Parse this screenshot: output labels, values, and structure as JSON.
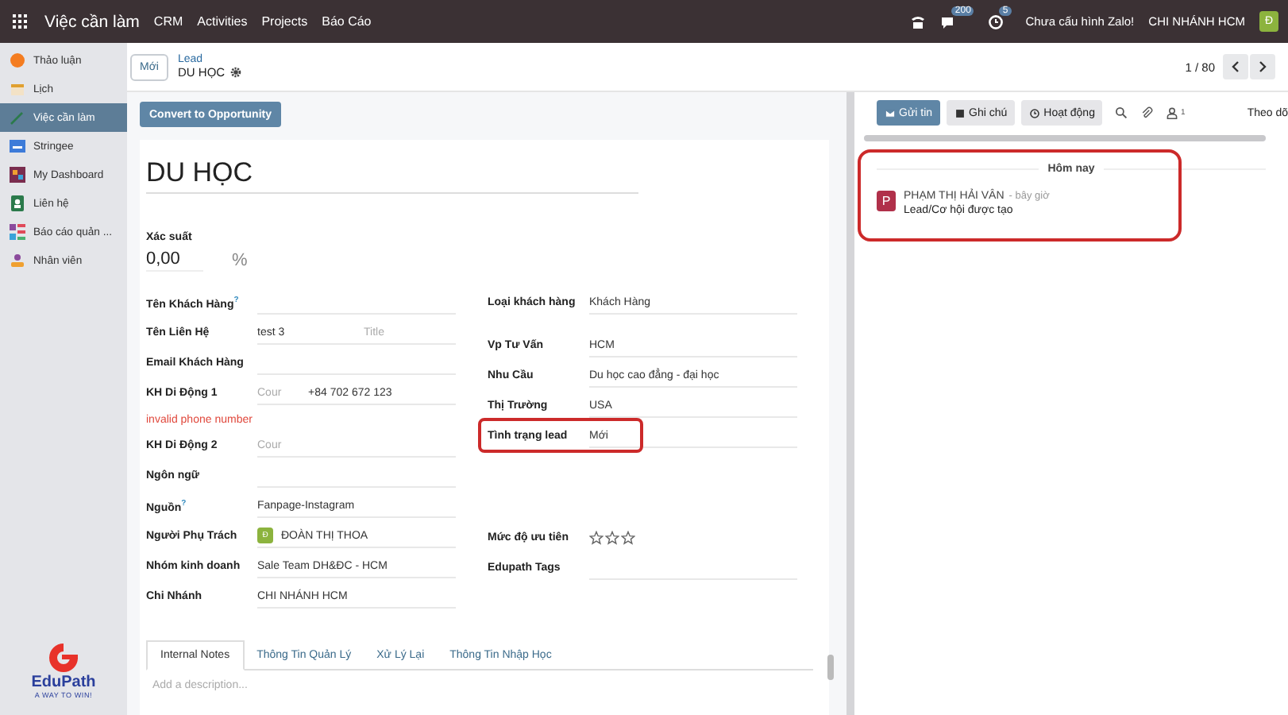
{
  "navbar": {
    "app_name": "Việc cần làm",
    "menu": [
      "CRM",
      "Activities",
      "Projects",
      "Báo Cáo"
    ],
    "messages_count": "200",
    "activities_count": "5",
    "zalo_status": "Chưa cấu hình Zalo!",
    "company": "CHI NHÁNH HCM",
    "user_initial": "Đ"
  },
  "sidebar": {
    "items": [
      {
        "label": "Thảo luận",
        "selected": false
      },
      {
        "label": "Lịch",
        "selected": false
      },
      {
        "label": "Việc cần làm",
        "selected": true
      },
      {
        "label": "Stringee",
        "selected": false
      },
      {
        "label": "My Dashboard",
        "selected": false
      },
      {
        "label": "Liên hệ",
        "selected": false
      },
      {
        "label": "Báo cáo quản ...",
        "selected": false
      },
      {
        "label": "Nhân viên",
        "selected": false
      }
    ],
    "logo": {
      "name": "EduPath",
      "tagline": "A WAY TO WIN!"
    }
  },
  "control_panel": {
    "new_button": "Mới",
    "breadcrumb": "Lead",
    "record_name": "DU HỌC",
    "pager": "1 / 80"
  },
  "form": {
    "convert_button": "Convert to Opportunity",
    "title": "DU HỌC",
    "probability_label": "Xác suất",
    "probability": "0,00",
    "percent": "%",
    "left_fields": [
      {
        "kind": "text",
        "label": "Tên Khách Hàng",
        "help": "?"
      },
      {
        "kind": "name",
        "label": "Tên Liên Hệ",
        "value": "test 3",
        "placeholder": "Title"
      },
      {
        "kind": "text",
        "label": "Email Khách Hàng"
      },
      {
        "kind": "phone",
        "label": "KH Di Động 1",
        "placeholder": "Cour",
        "value": "+84 702 672 123",
        "error": "invalid phone number"
      },
      {
        "kind": "phone",
        "label": "KH Di Động 2",
        "placeholder": "Cour"
      },
      {
        "kind": "text",
        "label": "Ngôn ngữ"
      },
      {
        "kind": "text",
        "label": "Nguồn",
        "help": "?",
        "value": "Fanpage-Instagram"
      },
      {
        "kind": "user",
        "label": "Người Phụ Trách",
        "initial": "Đ",
        "value": "ĐOÀN THỊ THOA"
      },
      {
        "kind": "text",
        "label": "Nhóm kinh doanh",
        "value": "Sale Team DH&ĐC - HCM"
      },
      {
        "kind": "text",
        "label": "Chi Nhánh",
        "value": "CHI NHÁNH HCM"
      }
    ],
    "right_fields": [
      {
        "kind": "text",
        "label": "Loại khách hàng",
        "value": "Khách Hàng",
        "highlighted": false
      },
      {
        "kind": "text",
        "label": "Vp Tư Vấn",
        "value": "HCM",
        "highlighted": false
      },
      {
        "kind": "text",
        "label": "Nhu Cầu",
        "value": "Du học cao đẳng - đại học",
        "highlighted": false
      },
      {
        "kind": "text",
        "label": "Thị Trường",
        "value": "USA",
        "highlighted": false
      },
      {
        "kind": "text",
        "label": "Tình trạng lead",
        "value": "Mới",
        "highlighted": true
      },
      {
        "kind": "priority",
        "label": "Mức độ ưu tiên",
        "stars": 0,
        "highlighted": false
      },
      {
        "kind": "text",
        "label": "Edupath Tags",
        "highlighted": false
      }
    ],
    "tabs": [
      {
        "label": "Internal Notes",
        "selected": true
      },
      {
        "label": "Thông Tin Quản Lý",
        "selected": false
      },
      {
        "label": "Xử Lý Lại",
        "selected": false
      },
      {
        "label": "Thông Tin Nhập Học",
        "selected": false
      }
    ],
    "description_placeholder": "Add a description..."
  },
  "chatter": {
    "buttons": [
      {
        "label": "Gửi tin",
        "selected": true
      },
      {
        "label": "Ghi chú",
        "selected": false
      },
      {
        "label": "Hoạt động",
        "selected": false
      }
    ],
    "followers_count": "1",
    "follow": "Theo dõ",
    "highlighted": true,
    "date_label": "Hôm nay",
    "messages": [
      {
        "avatar": "P",
        "author": "PHẠM THỊ HẢI VÂN",
        "time": "- bây giờ",
        "body": "Lead/Cơ hội được tạo"
      }
    ]
  }
}
